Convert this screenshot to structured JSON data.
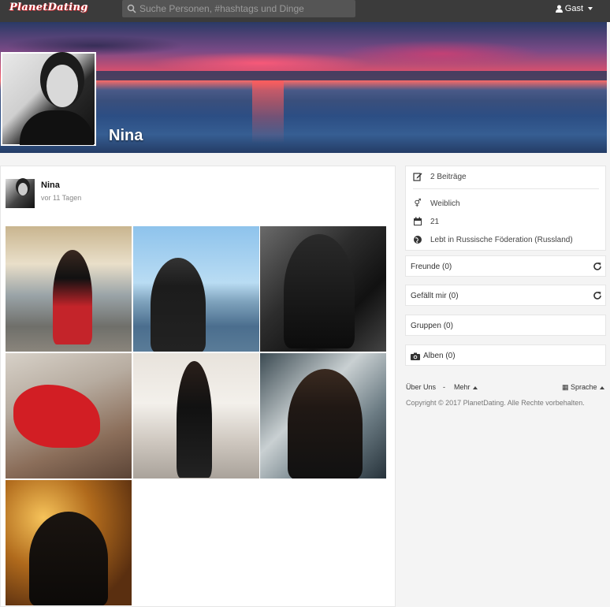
{
  "topbar": {
    "logo": "PlanetDating",
    "search_placeholder": "Suche Personen, #hashtags und Dinge",
    "guest_label": "Gast"
  },
  "profile": {
    "name": "Nina"
  },
  "post": {
    "author": "Nina",
    "time": "vor 11 Tagen",
    "photo_count": 7
  },
  "info": {
    "posts": "2 Beiträge",
    "gender": "Weiblich",
    "age": "21",
    "location": "Lebt in Russische Föderation (Russland)"
  },
  "sidebar": {
    "friends": "Freunde (0)",
    "likes": "Gefällt mir (0)",
    "groups": "Gruppen (0)",
    "albums": "Alben (0)"
  },
  "footer": {
    "about": "Über Uns",
    "separator": "-",
    "more": "Mehr",
    "language": "Sprache",
    "copyright": "Copyright © 2017 PlanetDating. Alle Rechte vorbehalten."
  },
  "colors": {
    "topbar": "#3b3b3b",
    "accent_red": "#b3262b"
  }
}
